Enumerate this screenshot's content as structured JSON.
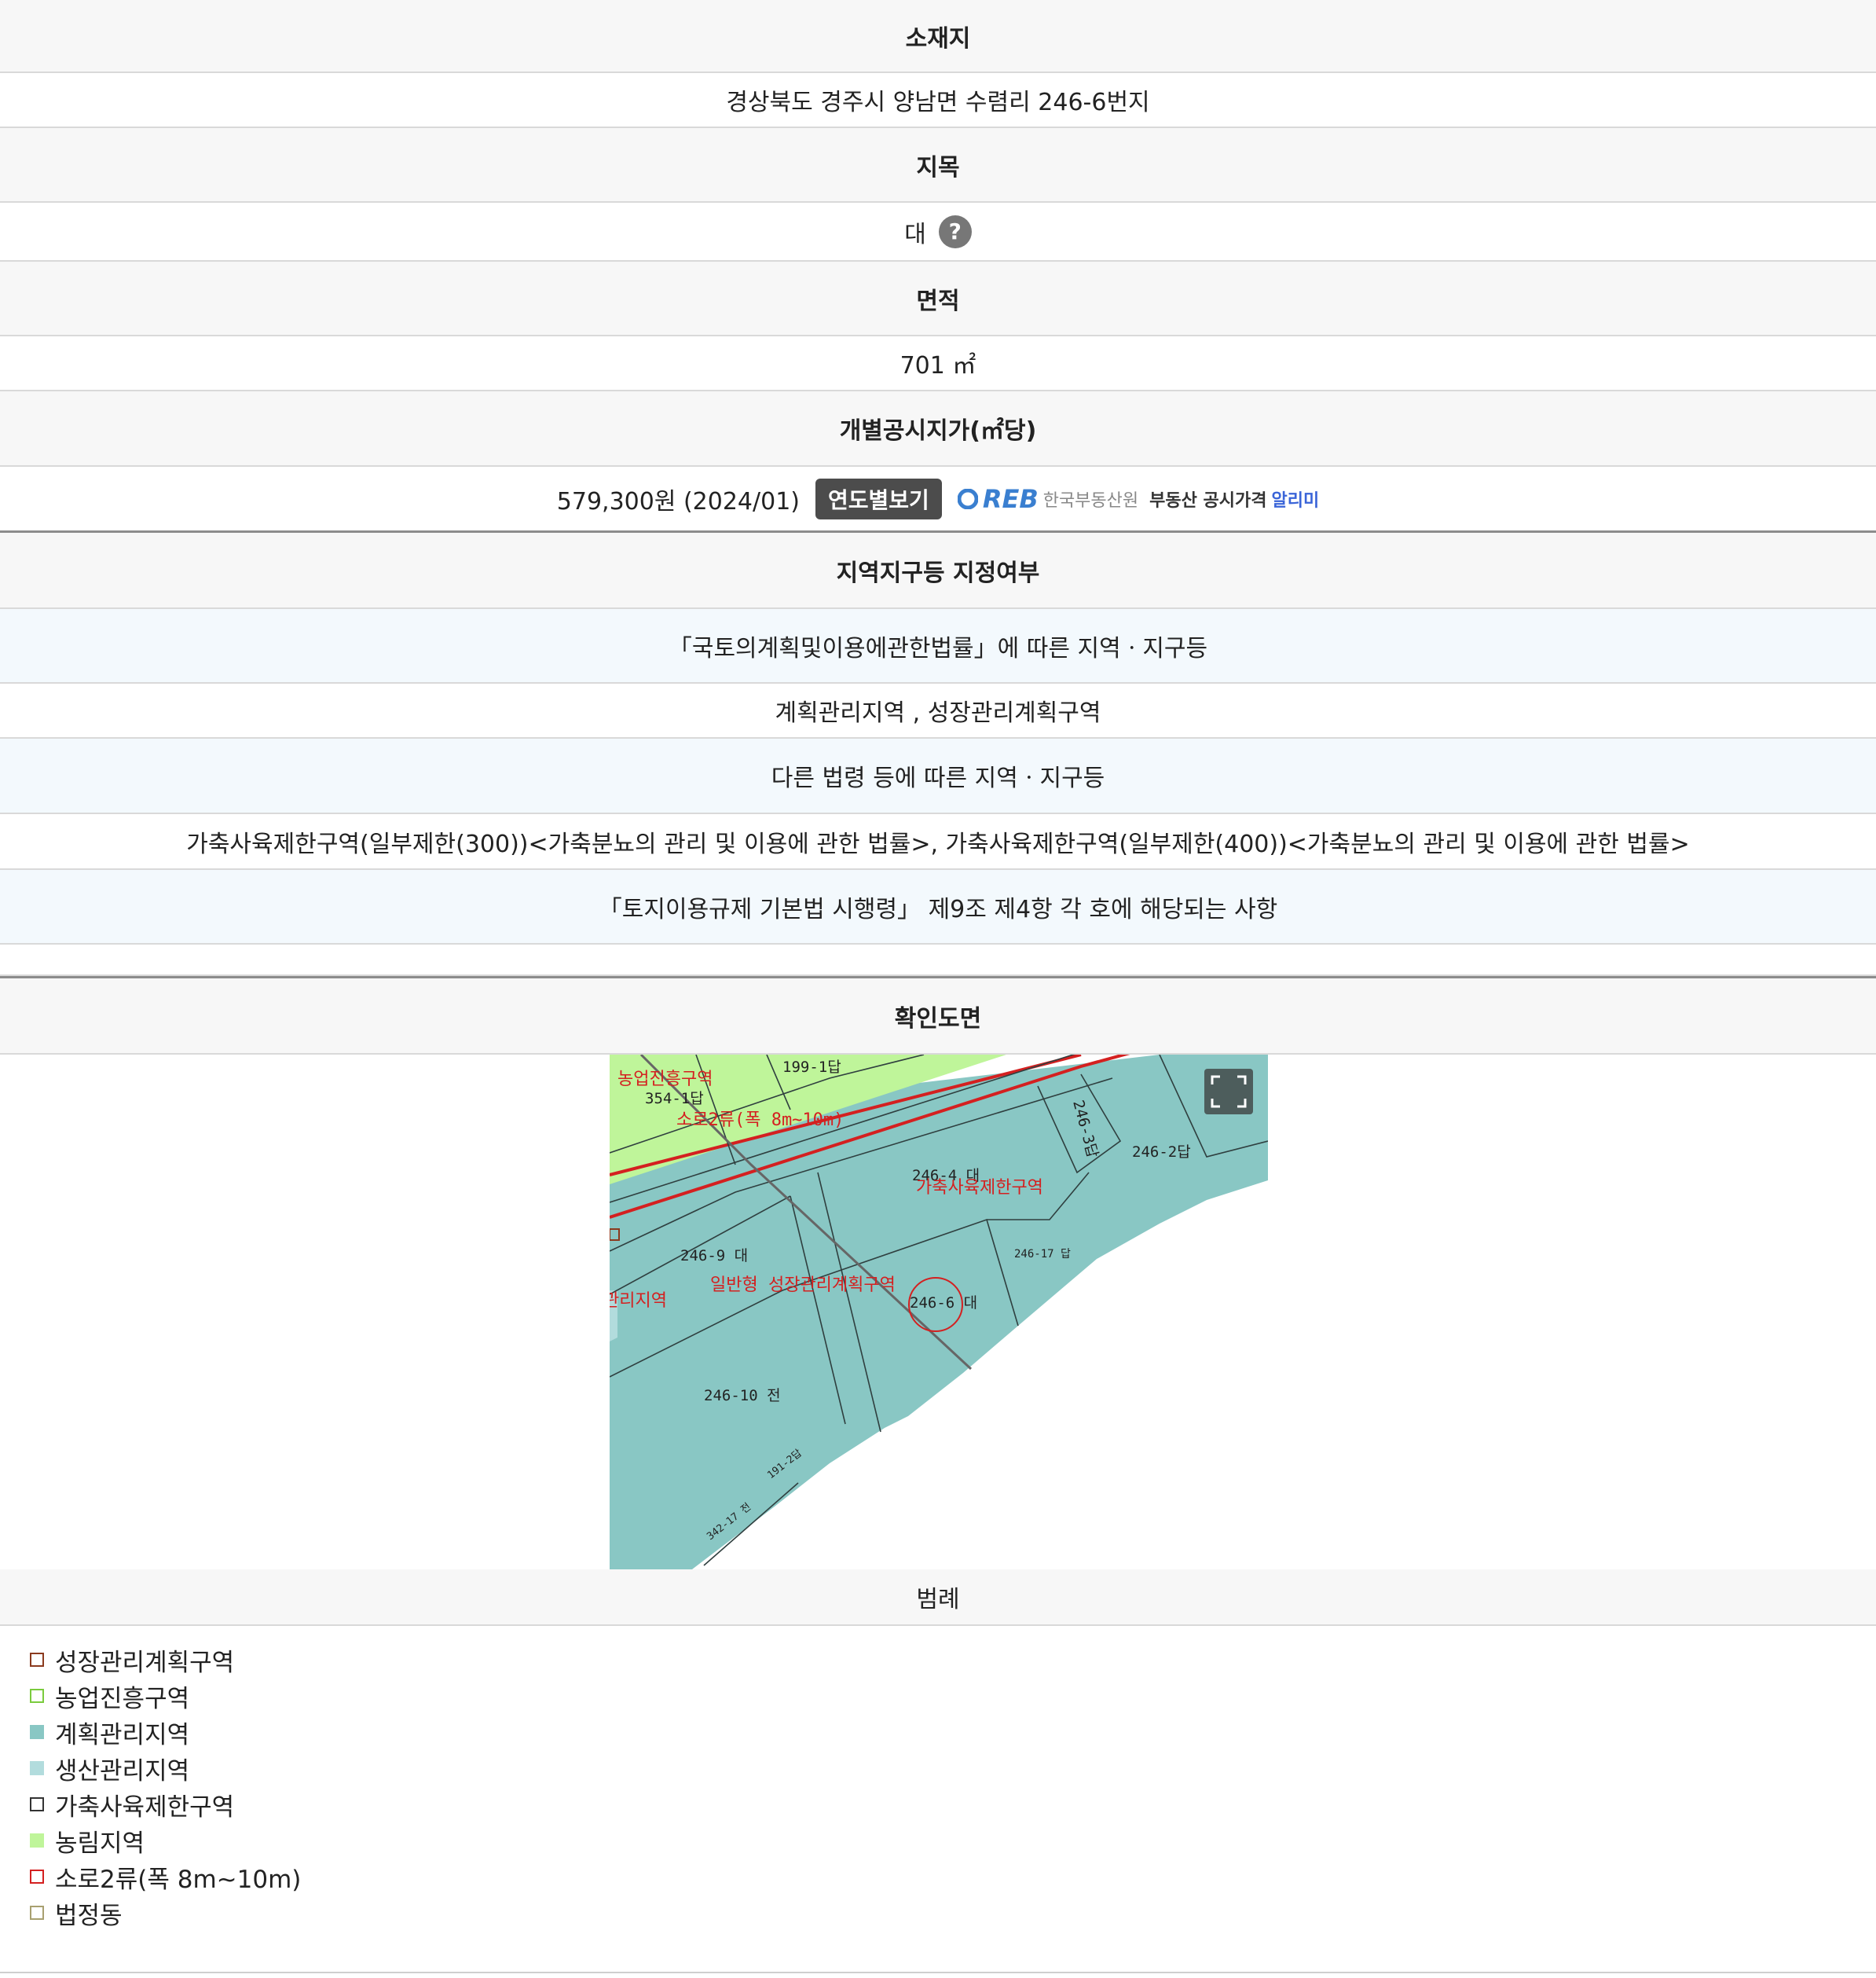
{
  "location": {
    "label": "소재지",
    "value": "경상북도 경주시 양남면 수렴리 246-6번지"
  },
  "jimok": {
    "label": "지목",
    "value": "대",
    "help_symbol": "?"
  },
  "area": {
    "label": "면적",
    "value": "701 ㎡"
  },
  "price": {
    "label": "개별공시지가(㎡당)",
    "value": "579,300원 (2024/01)",
    "button": "연도별보기",
    "reb_logo": "REB",
    "reb_org": "한국부동산원",
    "reb_notice": "부동산 공시가격",
    "reb_alert": "알리미"
  },
  "zoning": {
    "label": "지역지구등 지정여부",
    "national_law_header": "「국토의계획및이용에관한법률」에 따른 지역ㆍ지구등",
    "national_law_value": "계획관리지역 , 성장관리계획구역",
    "other_law_header": "다른 법령 등에 따른 지역ㆍ지구등",
    "other_law_value": "가축사육제한구역(일부제한(300))<가축분뇨의 관리 및 이용에 관한 법률>, 가축사육제한구역(일부제한(400))<가축분뇨의 관리 및 이용에 관한 법률>",
    "enforcement_header": "「토지이용규제 기본법 시행령」 제9조 제4항 각 호에 해당되는 사항",
    "enforcement_value": ""
  },
  "map": {
    "label": "확인도면",
    "labels": {
      "agri_promo": "농업진흥구역",
      "parcel_354": "354-1답",
      "parcel_199": "199-1답",
      "road": "소로2류(폭 8m~10m)",
      "parcel_246_4": "246-4 대",
      "livestock": "가축사육제한구역",
      "parcel_246_3": "246-3답",
      "parcel_246_2": "246-2답",
      "parcel_246_17": "246-17 답",
      "parcel_246_9": "246-9 대",
      "growth_plan": "일반형 성장관리계획구역",
      "mgmt_area": "관리지역",
      "parcel_246_6": "246-6 대",
      "parcel_246_10": "246-10 전",
      "parcel_342": "342-17 전",
      "parcel_191": "191-2답"
    },
    "colors": {
      "plan_mgmt": "#89c7c4",
      "production_mgmt": "#b2dcdd",
      "agri_forest": "#bff59a",
      "road_red": "#d42020"
    }
  },
  "legend": {
    "label": "범례",
    "items": [
      {
        "label": "성장관리계획구역",
        "color": "#8b3a1e",
        "filled": false
      },
      {
        "label": "농업진흥구역",
        "color": "#7acb3d",
        "filled": false
      },
      {
        "label": "계획관리지역",
        "color": "#89c7c4",
        "filled": true
      },
      {
        "label": "생산관리지역",
        "color": "#b2dcdd",
        "filled": true
      },
      {
        "label": "가축사육제한구역",
        "color": "#333333",
        "filled": false
      },
      {
        "label": "농림지역",
        "color": "#bff59a",
        "filled": true
      },
      {
        "label": "소로2류(폭 8m~10m)",
        "color": "#d42020",
        "filled": false
      },
      {
        "label": "법정동",
        "color": "#a8a070",
        "filled": false
      }
    ]
  }
}
